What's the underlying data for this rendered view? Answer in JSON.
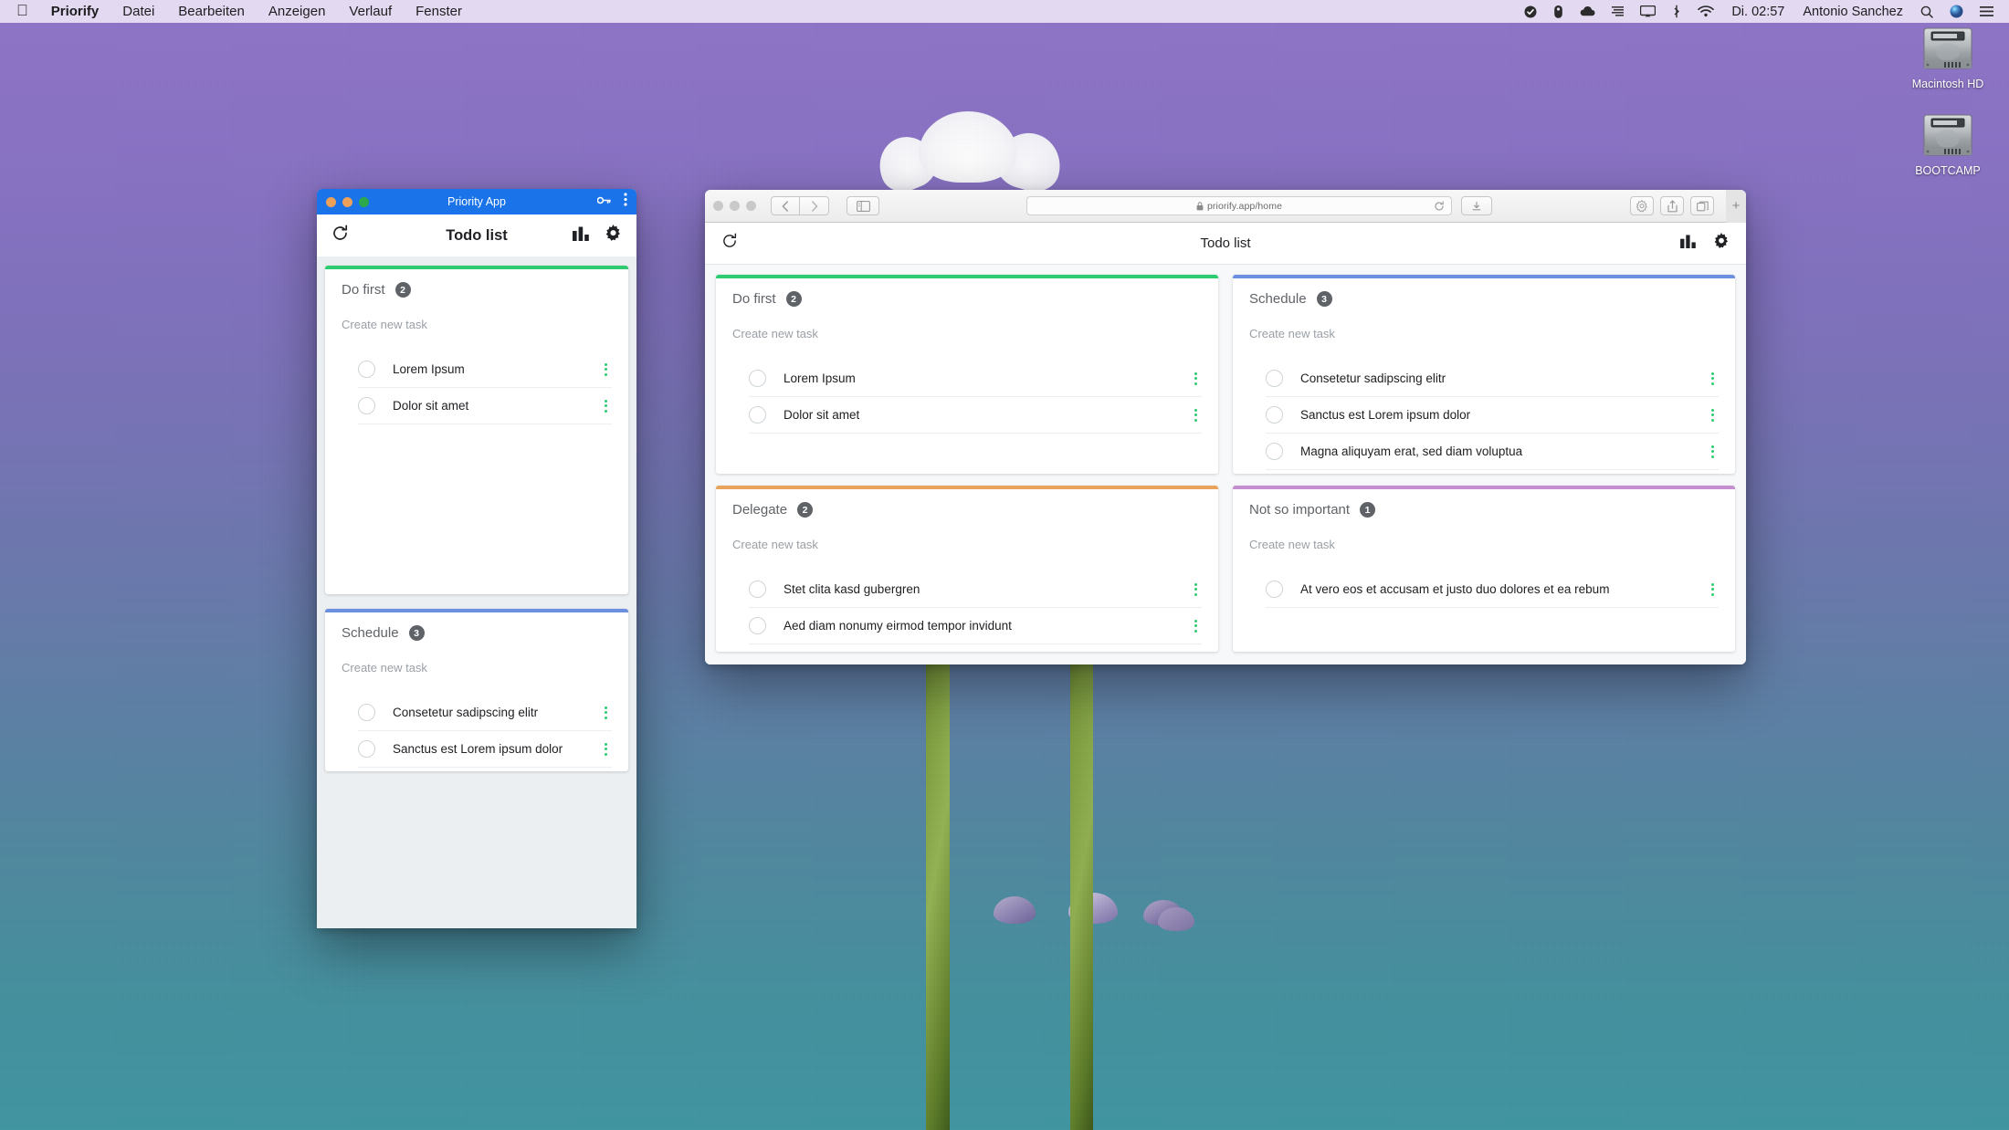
{
  "menubar": {
    "apple_glyph": "",
    "items": [
      {
        "label": "Priorify",
        "bold": true
      },
      {
        "label": "Datei",
        "bold": false
      },
      {
        "label": "Bearbeiten",
        "bold": false
      },
      {
        "label": "Anzeigen",
        "bold": false
      },
      {
        "label": "Verlauf",
        "bold": false
      },
      {
        "label": "Fenster",
        "bold": false
      }
    ],
    "status_icons": [
      "checkmark-circle-icon",
      "dropbox-icon",
      "cloud-icon",
      "equalizer-icon",
      "airplay-icon",
      "bluetooth-icon",
      "wifi-icon"
    ],
    "clock": "Di. 02:57",
    "user": "Antonio Sanchez",
    "right_icons": [
      "spotlight-search-icon",
      "siri-icon",
      "control-center-icon"
    ]
  },
  "desktop": {
    "icons": [
      {
        "label": "Macintosh HD",
        "icon": "hard-drive-icon"
      },
      {
        "label": "BOOTCAMP",
        "icon": "hard-drive-icon"
      }
    ]
  },
  "mobile_window": {
    "title": "Priority App",
    "key_icon": "key-icon",
    "menu_icon": "vertical-dots-icon",
    "appbar": {
      "refresh_icon": "refresh-icon",
      "title": "Todo list",
      "chart_icon": "bar-chart-icon",
      "settings_icon": "gear-icon"
    },
    "cards": [
      {
        "title": "Do first",
        "count": "2",
        "accent": "#2ecc71",
        "create_label": "Create new task",
        "tasks": [
          "Lorem Ipsum",
          "Dolor sit amet"
        ]
      },
      {
        "title": "Schedule",
        "count": "3",
        "accent": "#6d8fe0",
        "create_label": "Create new task",
        "tasks": [
          "Consetetur sadipscing elitr",
          "Sanctus est Lorem ipsum dolor"
        ]
      }
    ]
  },
  "safari_window": {
    "toolbar": {
      "back_icon": "chevron-left-icon",
      "forward_icon": "chevron-right-icon",
      "sidebar_icon": "sidebar-icon",
      "lock_icon": "lock-icon",
      "url": "priorify.app/home",
      "reload_icon": "reload-icon",
      "download_icon": "download-icon",
      "extensions_icon": "gear-icon",
      "share_icon": "share-icon",
      "tabs_icon": "tab-overview-icon",
      "newtab_label": "+"
    },
    "appbar": {
      "refresh_icon": "refresh-icon",
      "title": "Todo list",
      "chart_icon": "bar-chart-icon",
      "settings_icon": "gear-icon"
    },
    "cards": [
      {
        "title": "Do first",
        "count": "2",
        "accent": "#2ecc71",
        "create_label": "Create new task",
        "tasks": [
          "Lorem Ipsum",
          "Dolor sit amet"
        ]
      },
      {
        "title": "Schedule",
        "count": "3",
        "accent": "#6d8fe0",
        "create_label": "Create new task",
        "tasks": [
          "Consetetur sadipscing elitr",
          "Sanctus est Lorem ipsum dolor",
          "Magna aliquyam erat, sed diam voluptua"
        ]
      },
      {
        "title": "Delegate",
        "count": "2",
        "accent": "#e8a35c",
        "create_label": "Create new task",
        "tasks": [
          "Stet clita kasd gubergren",
          "Aed diam nonumy eirmod tempor invidunt"
        ]
      },
      {
        "title": "Not so important",
        "count": "1",
        "accent": "#c48ed0",
        "create_label": "Create new task",
        "tasks": [
          "At vero eos et accusam et justo duo dolores et ea rebum"
        ]
      }
    ]
  }
}
